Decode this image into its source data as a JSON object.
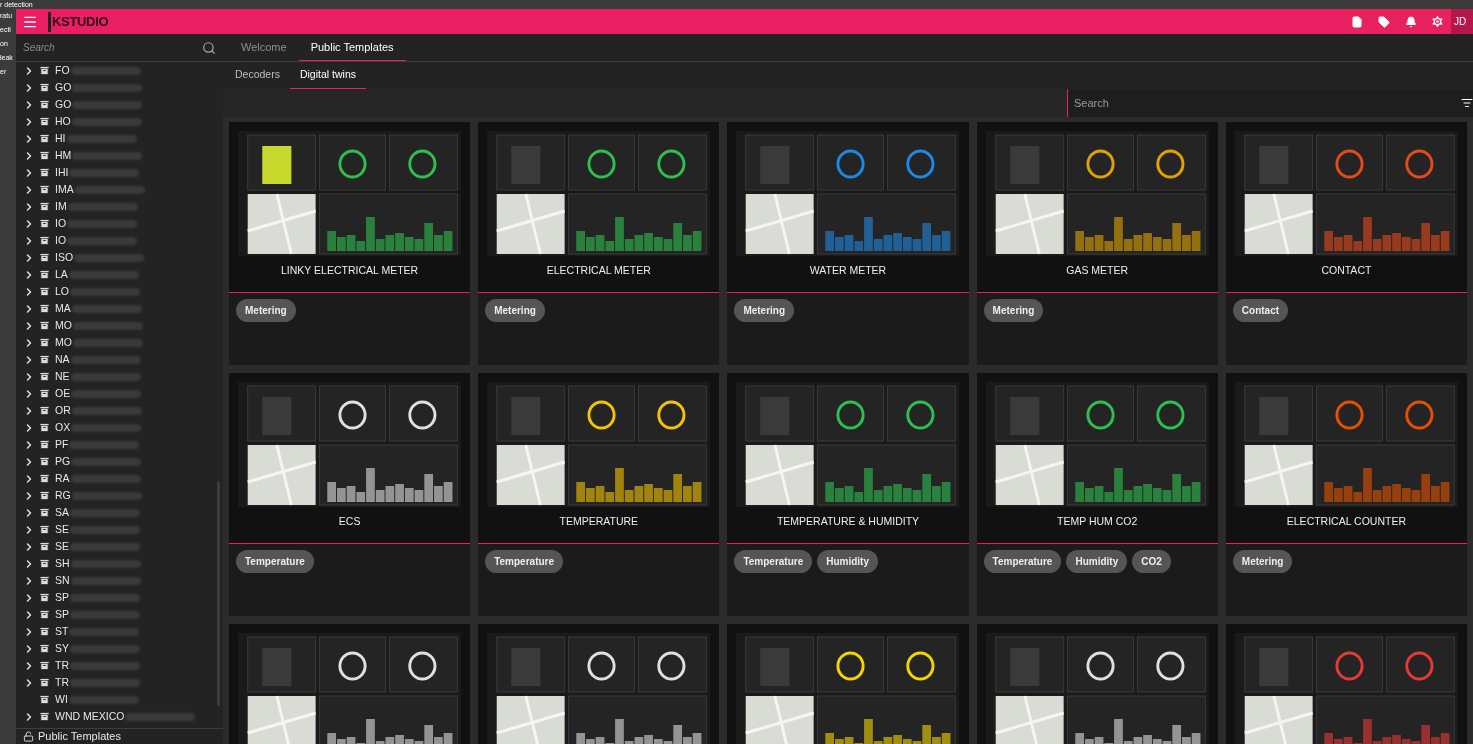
{
  "background_window": {
    "lines": [
      "r detection",
      "ratu",
      "ecti",
      "on",
      "leak",
      "er"
    ]
  },
  "header": {
    "logo": "KSTUDIO",
    "user_initials": "JD"
  },
  "sidebar": {
    "search": {
      "placeholder": "Search"
    },
    "items": [
      {
        "label": "FO",
        "expandable": true
      },
      {
        "label": "GO",
        "expandable": true
      },
      {
        "label": "GO",
        "expandable": true
      },
      {
        "label": "HO",
        "expandable": true
      },
      {
        "label": "HI",
        "expandable": true
      },
      {
        "label": "HM",
        "expandable": true
      },
      {
        "label": "IHI",
        "expandable": true
      },
      {
        "label": "IMA",
        "expandable": true
      },
      {
        "label": "IM",
        "expandable": true
      },
      {
        "label": "IO",
        "expandable": true
      },
      {
        "label": "IO",
        "expandable": true
      },
      {
        "label": "ISO",
        "expandable": true
      },
      {
        "label": "LA",
        "expandable": true
      },
      {
        "label": "LO",
        "expandable": true
      },
      {
        "label": "MA",
        "expandable": true
      },
      {
        "label": "MO",
        "expandable": true
      },
      {
        "label": "MO",
        "expandable": true
      },
      {
        "label": "NA",
        "expandable": true
      },
      {
        "label": "NE",
        "expandable": true
      },
      {
        "label": "OE",
        "expandable": true
      },
      {
        "label": "OR",
        "expandable": true
      },
      {
        "label": "OX",
        "expandable": true
      },
      {
        "label": "PF",
        "expandable": true
      },
      {
        "label": "PG",
        "expandable": true
      },
      {
        "label": "RA",
        "expandable": true
      },
      {
        "label": "RG",
        "expandable": true
      },
      {
        "label": "SA",
        "expandable": true
      },
      {
        "label": "SE",
        "expandable": true
      },
      {
        "label": "SE",
        "expandable": true
      },
      {
        "label": "SH",
        "expandable": true
      },
      {
        "label": "SN",
        "expandable": true
      },
      {
        "label": "SP",
        "expandable": true
      },
      {
        "label": "SP",
        "expandable": true
      },
      {
        "label": "ST",
        "expandable": true
      },
      {
        "label": "SY",
        "expandable": true
      },
      {
        "label": "TR",
        "expandable": true
      },
      {
        "label": "TR",
        "expandable": true
      },
      {
        "label": "WI",
        "expandable": false
      },
      {
        "label": "WND MEXICO",
        "expandable": true
      }
    ],
    "footer": "Public Templates"
  },
  "tabs": [
    {
      "label": "Welcome",
      "selected": false
    },
    {
      "label": "Public Templates",
      "selected": true
    }
  ],
  "subtabs": [
    {
      "label": "Decoders",
      "selected": false
    },
    {
      "label": "Digital twins",
      "selected": true
    }
  ],
  "search": {
    "placeholder": "Search"
  },
  "cards": [
    {
      "kind": "full",
      "title": "LINKY ELECTRICAL METER",
      "tags": [
        "Metering"
      ]
    },
    {
      "kind": "full",
      "title": "ELECTRICAL METER",
      "tags": [
        "Metering"
      ]
    },
    {
      "kind": "full",
      "title": "WATER METER",
      "tags": [
        "Metering"
      ]
    },
    {
      "kind": "full",
      "title": "GAS METER",
      "tags": [
        "Metering"
      ]
    },
    {
      "kind": "full",
      "title": "CONTACT",
      "tags": [
        "Contact"
      ]
    },
    {
      "kind": "full",
      "title": "ECS",
      "tags": [
        "Temperature"
      ]
    },
    {
      "kind": "full",
      "title": "TEMPERATURE",
      "tags": [
        "Temperature"
      ]
    },
    {
      "kind": "full",
      "title": "TEMPERATURE & HUMIDITY",
      "tags": [
        "Temperature",
        "Humidity"
      ]
    },
    {
      "kind": "full",
      "title": "TEMP HUM CO2",
      "tags": [
        "Temperature",
        "Humidity",
        "CO2"
      ]
    },
    {
      "kind": "full",
      "title": "ELECTRICAL COUNTER",
      "tags": [
        "Metering"
      ]
    },
    {
      "kind": "cut"
    },
    {
      "kind": "cut"
    },
    {
      "kind": "cut"
    },
    {
      "kind": "cut"
    },
    {
      "kind": "cut"
    }
  ]
}
